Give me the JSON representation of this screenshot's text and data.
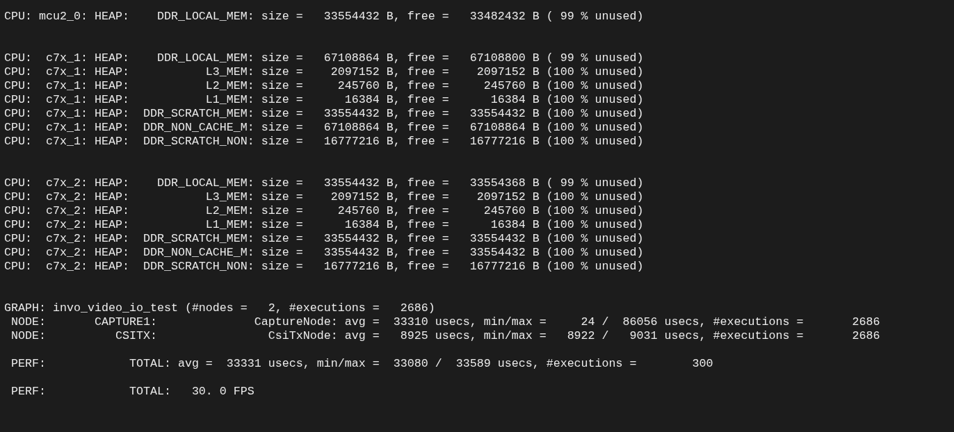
{
  "terminal": {
    "sections": [
      {
        "kind": "heap",
        "lines": [
          "CPU: mcu2_0: HEAP:    DDR_LOCAL_MEM: size =   33554432 B, free =   33482432 B ( 99 % unused)"
        ]
      },
      {
        "kind": "heap",
        "lines": [
          "CPU:  c7x_1: HEAP:    DDR_LOCAL_MEM: size =   67108864 B, free =   67108800 B ( 99 % unused)",
          "CPU:  c7x_1: HEAP:           L3_MEM: size =    2097152 B, free =    2097152 B (100 % unused)",
          "CPU:  c7x_1: HEAP:           L2_MEM: size =     245760 B, free =     245760 B (100 % unused)",
          "CPU:  c7x_1: HEAP:           L1_MEM: size =      16384 B, free =      16384 B (100 % unused)",
          "CPU:  c7x_1: HEAP:  DDR_SCRATCH_MEM: size =   33554432 B, free =   33554432 B (100 % unused)",
          "CPU:  c7x_1: HEAP:  DDR_NON_CACHE_M: size =   67108864 B, free =   67108864 B (100 % unused)",
          "CPU:  c7x_1: HEAP:  DDR_SCRATCH_NON: size =   16777216 B, free =   16777216 B (100 % unused)"
        ]
      },
      {
        "kind": "heap",
        "lines": [
          "CPU:  c7x_2: HEAP:    DDR_LOCAL_MEM: size =   33554432 B, free =   33554368 B ( 99 % unused)",
          "CPU:  c7x_2: HEAP:           L3_MEM: size =    2097152 B, free =    2097152 B (100 % unused)",
          "CPU:  c7x_2: HEAP:           L2_MEM: size =     245760 B, free =     245760 B (100 % unused)",
          "CPU:  c7x_2: HEAP:           L1_MEM: size =      16384 B, free =      16384 B (100 % unused)",
          "CPU:  c7x_2: HEAP:  DDR_SCRATCH_MEM: size =   33554432 B, free =   33554432 B (100 % unused)",
          "CPU:  c7x_2: HEAP:  DDR_NON_CACHE_M: size =   33554432 B, free =   33554432 B (100 % unused)",
          "CPU:  c7x_2: HEAP:  DDR_SCRATCH_NON: size =   16777216 B, free =   16777216 B (100 % unused)"
        ]
      },
      {
        "kind": "graph",
        "lines": [
          "GRAPH: invo_video_io_test (#nodes =   2, #executions =   2686)",
          " NODE:       CAPTURE1:              CaptureNode: avg =  33310 usecs, min/max =     24 /  86056 usecs, #executions =       2686",
          " NODE:          CSITX:                CsiTxNode: avg =   8925 usecs, min/max =   8922 /   9031 usecs, #executions =       2686"
        ]
      },
      {
        "kind": "perf",
        "lines": [
          " PERF:            TOTAL: avg =  33331 usecs, min/max =  33080 /  33589 usecs, #executions =        300"
        ]
      },
      {
        "kind": "perf",
        "lines": [
          " PERF:            TOTAL:   30. 0 FPS"
        ]
      }
    ]
  }
}
